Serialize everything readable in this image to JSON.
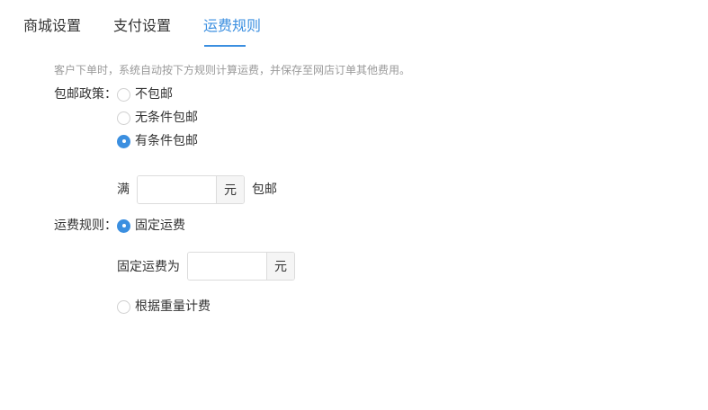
{
  "tabs": [
    {
      "label": "商城设置",
      "active": false
    },
    {
      "label": "支付设置",
      "active": false
    },
    {
      "label": "运费规则",
      "active": true
    }
  ],
  "description": "客户下单时，系统自动按下方规则计算运费，并保存至网店订单其他费用。",
  "free_shipping": {
    "label": "包邮政策：",
    "options": [
      {
        "label": "不包邮",
        "checked": false
      },
      {
        "label": "无条件包邮",
        "checked": false
      },
      {
        "label": "有条件包邮",
        "checked": true
      }
    ],
    "threshold": {
      "prefix": "满",
      "value": "",
      "unit": "元",
      "suffix": "包邮"
    }
  },
  "shipping_rule": {
    "label": "运费规则：",
    "fixed": {
      "label": "固定运费",
      "checked": true,
      "amount_label": "固定运费为",
      "value": "",
      "unit": "元"
    },
    "weight": {
      "label": "根据重量计费",
      "checked": false
    }
  },
  "colors": {
    "accent": "#3b8fe0",
    "text": "#333333",
    "muted": "#9a9a9a",
    "border": "#dcdcdc"
  }
}
